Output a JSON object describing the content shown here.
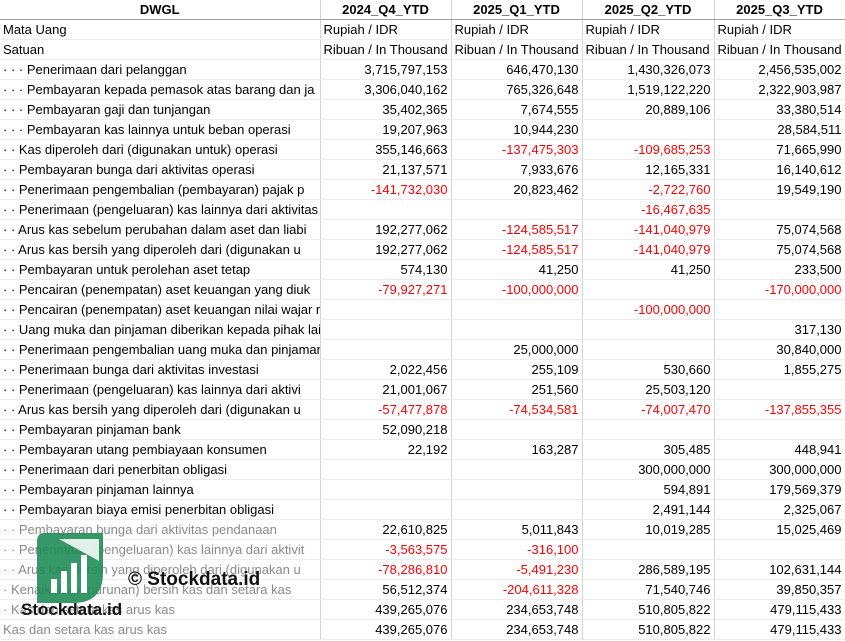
{
  "sheet": {
    "ticker": "DWGL",
    "columns": [
      "2024_Q4_YTD",
      "2025_Q1_YTD",
      "2025_Q2_YTD",
      "2025_Q3_YTD"
    ]
  },
  "colors": {
    "negative": "#ff0000",
    "faded_text": "#8a8a8a",
    "watermark_green": "#1a8a52"
  },
  "rows": [
    {
      "label": "Mata Uang",
      "v": [
        "Rupiah / IDR",
        "Rupiah / IDR",
        "Rupiah / IDR",
        "Rupiah / IDR"
      ]
    },
    {
      "label": "Satuan",
      "v": [
        "Ribuan / In Thousand",
        "Ribuan / In Thousand",
        "Ribuan / In Thousand",
        "Ribuan / In Thousand"
      ]
    },
    {
      "label": "· · · Penerimaan dari pelanggan",
      "v": [
        "3,715,797,153",
        "646,470,130",
        "1,430,326,073",
        "2,456,535,002"
      ]
    },
    {
      "label": "· · · Pembayaran kepada pemasok atas barang dan ja",
      "v": [
        "3,306,040,162",
        "765,326,648",
        "1,519,122,220",
        "2,322,903,987"
      ]
    },
    {
      "label": "· · · Pembayaran gaji dan tunjangan",
      "v": [
        "35,402,365",
        "7,674,555",
        "20,889,106",
        "33,380,514"
      ]
    },
    {
      "label": "· · · Pembayaran kas lainnya untuk beban operasi",
      "v": [
        "19,207,963",
        "10,944,230",
        "",
        "28,584,511"
      ]
    },
    {
      "label": "· · Kas diperoleh dari (digunakan untuk) operasi",
      "v": [
        "355,146,663",
        "-137,475,303",
        "-109,685,253",
        "71,665,990"
      ]
    },
    {
      "label": "· · Pembayaran bunga dari aktivitas operasi",
      "v": [
        "21,137,571",
        "7,933,676",
        "12,165,331",
        "16,140,612"
      ]
    },
    {
      "label": "· · Penerimaan pengembalian (pembayaran) pajak p",
      "v": [
        "-141,732,030",
        "20,823,462",
        "-2,722,760",
        "19,549,190"
      ]
    },
    {
      "label": "· · Penerimaan (pengeluaran) kas lainnya dari aktivitas operasi",
      "v": [
        "",
        "",
        "-16,467,635",
        ""
      ]
    },
    {
      "label": "· · Arus kas sebelum perubahan dalam aset dan liabi",
      "v": [
        "192,277,062",
        "-124,585,517",
        "-141,040,979",
        "75,074,568"
      ]
    },
    {
      "label": "· · Arus kas bersih yang diperoleh dari (digunakan u",
      "v": [
        "192,277,062",
        "-124,585,517",
        "-141,040,979",
        "75,074,568"
      ]
    },
    {
      "label": "· · Pembayaran untuk perolehan aset tetap",
      "v": [
        "574,130",
        "41,250",
        "41,250",
        "233,500"
      ]
    },
    {
      "label": "· · Pencairan (penempatan) aset keuangan yang diuk",
      "v": [
        "-79,927,271",
        "-100,000,000",
        "",
        "-170,000,000"
      ]
    },
    {
      "label": "· · Pencairan (penempatan) aset keuangan nilai wajar melalui pendapatan komprehensif lainn",
      "v": [
        "",
        "",
        "-100,000,000",
        ""
      ]
    },
    {
      "label": "· · Uang muka dan pinjaman diberikan kepada pihak lain, selain institusi keuangan",
      "v": [
        "",
        "",
        "",
        "317,130"
      ]
    },
    {
      "label": "· · Penerimaan pengembalian uang muka dan pinjaman diberikan kepada",
      "v": [
        "",
        "25,000,000",
        "",
        "30,840,000"
      ]
    },
    {
      "label": "· · Penerimaan bunga dari aktivitas investasi",
      "v": [
        "2,022,456",
        "255,109",
        "530,660",
        "1,855,275"
      ]
    },
    {
      "label": "· · Penerimaan (pengeluaran) kas lainnya dari aktivi",
      "v": [
        "21,001,067",
        "251,560",
        "25,503,120",
        ""
      ]
    },
    {
      "label": "· · Arus kas bersih yang diperoleh dari (digunakan u",
      "v": [
        "-57,477,878",
        "-74,534,581",
        "-74,007,470",
        "-137,855,355"
      ]
    },
    {
      "label": "· · Pembayaran pinjaman bank",
      "v": [
        "52,090,218",
        "",
        "",
        ""
      ]
    },
    {
      "label": "· · Pembayaran utang pembiayaan konsumen",
      "v": [
        "22,192",
        "163,287",
        "305,485",
        "448,941"
      ]
    },
    {
      "label": "· · Penerimaan dari penerbitan obligasi",
      "v": [
        "",
        "",
        "300,000,000",
        "300,000,000"
      ]
    },
    {
      "label": "· · Pembayaran pinjaman lainnya",
      "v": [
        "",
        "",
        "594,891",
        "179,569,379"
      ]
    },
    {
      "label": "· · Pembayaran biaya emisi penerbitan obligasi",
      "v": [
        "",
        "",
        "2,491,144",
        "2,325,067"
      ]
    },
    {
      "label": "· · Pembayaran bunga dari aktivitas pendanaan",
      "v": [
        "22,610,825",
        "5,011,843",
        "10,019,285",
        "15,025,469"
      ],
      "faded": true
    },
    {
      "label": "· · Penerimaan (pengeluaran) kas lainnya dari aktivit",
      "v": [
        "-3,563,575",
        "-316,100",
        "",
        ""
      ],
      "faded": true
    },
    {
      "label": "· · Arus kas bersih yang diperoleh dari (digunakan u",
      "v": [
        "-78,286,810",
        "-5,491,230",
        "286,589,195",
        "102,631,144"
      ],
      "faded": true
    },
    {
      "label": "· Kenaikan (penurunan) bersih kas dan setara kas",
      "v": [
        "56,512,374",
        "-204,611,328",
        "71,540,746",
        "39,850,357"
      ],
      "faded": true
    },
    {
      "label": "· Kas dan setara kas arus kas",
      "v": [
        "439,265,076",
        "234,653,748",
        "510,805,822",
        "479,115,433"
      ],
      "faded": true
    },
    {
      "label": "Kas dan setara kas arus kas",
      "v": [
        "439,265,076",
        "234,653,748",
        "510,805,822",
        "479,115,433"
      ],
      "faded": true
    }
  ],
  "watermark": {
    "copyright": "© Stockdata.id",
    "brand": "Stockdata.id"
  }
}
